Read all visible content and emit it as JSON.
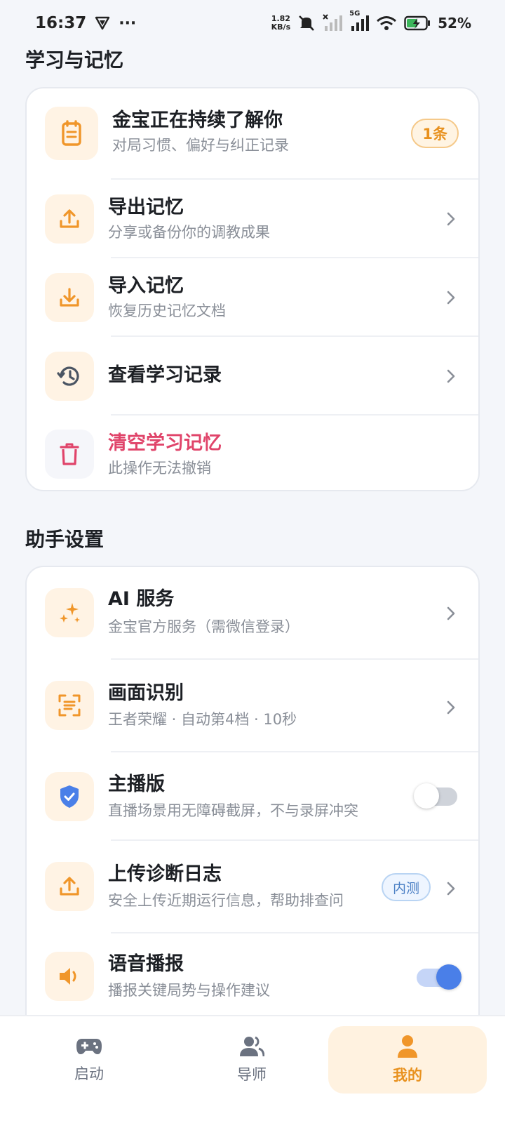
{
  "status_bar": {
    "time": "16:37",
    "dots": "···",
    "net_speed_value": "1.82",
    "net_speed_unit": "KB/s",
    "network": "5G",
    "battery": "52%"
  },
  "memory_section": {
    "title": "学习与记忆",
    "learning": {
      "title": "金宝正在持续了解你",
      "subtitle": "对局习惯、偏好与纠正记录",
      "badge": "1条"
    },
    "items": [
      {
        "title": "导出记忆",
        "subtitle": "分享或备份你的调教成果"
      },
      {
        "title": "导入记忆",
        "subtitle": "恢复历史记忆文档"
      },
      {
        "title": "查看学习记录",
        "subtitle": ""
      },
      {
        "title": "清空学习记忆",
        "subtitle": "此操作无法撤销"
      }
    ]
  },
  "assistant_section": {
    "title": "助手设置",
    "items": [
      {
        "title": "AI 服务",
        "subtitle": "金宝官方服务（需微信登录）"
      },
      {
        "title": "画面识别",
        "subtitle": "王者荣耀 · 自动第4档 · 10秒"
      },
      {
        "title": "主播版",
        "subtitle": "直播场景用无障碍截屏，不与录屏冲突",
        "toggle_on": false
      },
      {
        "title": "上传诊断日志",
        "subtitle": "安全上传近期运行信息，帮助排查问",
        "badge": "内测"
      },
      {
        "title": "语音播报",
        "subtitle": "播报关键局势与操作建议",
        "toggle_on": true
      }
    ]
  },
  "bottom_nav": {
    "items": [
      {
        "label": "启动",
        "icon": "gamepad-icon"
      },
      {
        "label": "导师",
        "icon": "users-icon"
      },
      {
        "label": "我的",
        "icon": "person-icon",
        "active": true
      }
    ]
  },
  "colors": {
    "accent": "#f0962a",
    "danger": "#e0446a",
    "toggle_on": "#4a7fe8",
    "active_tab": "#e8911e"
  }
}
